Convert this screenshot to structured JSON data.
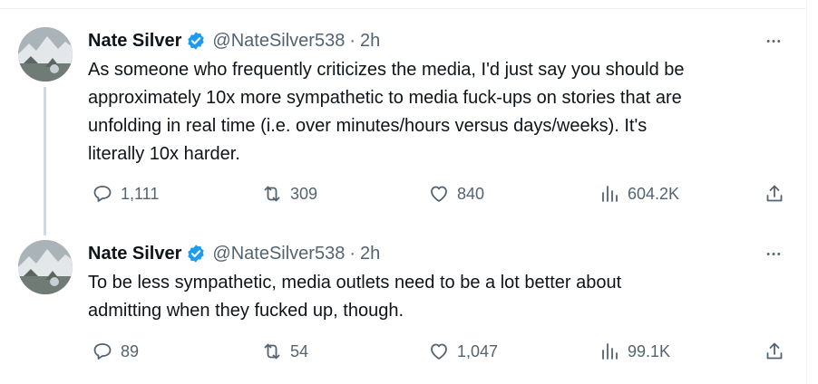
{
  "tweets": [
    {
      "author": {
        "name": "Nate Silver",
        "handle": "@NateSilver538",
        "time": "2h",
        "verified": true
      },
      "text": "As someone who frequently criticizes the media, I'd just say you should be approximately 10x more sympathetic to media fuck-ups on stories that are unfolding in real time (i.e. over minutes/hours versus days/weeks). It's literally 10x harder.",
      "text_lines": [
        "As someone who frequently criticizes the media, I'd just say you should be",
        "approximately 10x more sympathetic to media fuck-ups on stories that are",
        "unfolding in real time (i.e. over minutes/hours versus days/weeks). It's",
        "literally 10x harder."
      ],
      "stats": {
        "replies": "1,111",
        "retweets": "309",
        "likes": "840",
        "views": "604.2K"
      }
    },
    {
      "author": {
        "name": "Nate Silver",
        "handle": "@NateSilver538",
        "time": "2h",
        "verified": true
      },
      "text": "To be less sympathetic, media outlets need to be a lot better about admitting when they fucked up, though.",
      "text_lines": [
        "To be less sympathetic, media outlets need to be a lot better about",
        "admitting when they fucked up, though."
      ],
      "stats": {
        "replies": "89",
        "retweets": "54",
        "likes": "1,047",
        "views": "99.1K"
      }
    }
  ],
  "separator": "·",
  "more_label": "•••",
  "colors": {
    "text": "#0f1419",
    "muted": "#536471",
    "verified": "#1d9bf0",
    "thread_line": "#cfd9de"
  },
  "icons": [
    "verified-badge-icon",
    "more-icon",
    "reply-icon",
    "retweet-icon",
    "like-icon",
    "views-icon",
    "share-icon"
  ]
}
